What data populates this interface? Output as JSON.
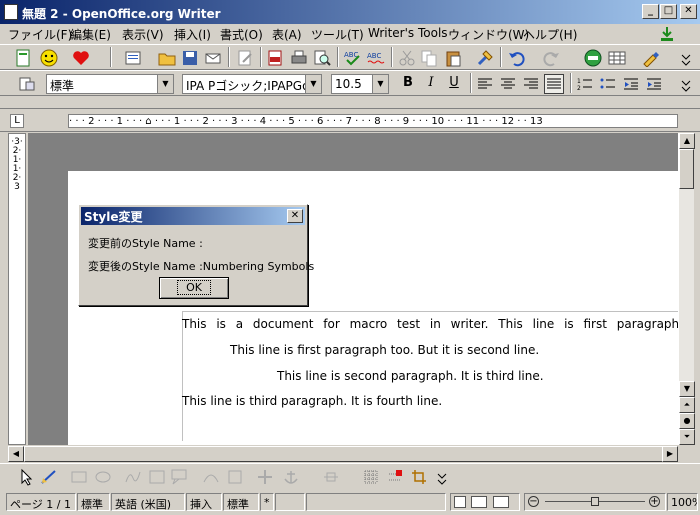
{
  "window": {
    "title": "無題 2 - OpenOffice.org Writer",
    "minimize": "_",
    "maximize": "□",
    "close": "✕"
  },
  "menu": [
    "ファイル(F)",
    "編集(E)",
    "表示(V)",
    "挿入(I)",
    "書式(O)",
    "表(A)",
    "ツール(T)",
    "Writer's Tools",
    "ウィンドウ(W)",
    "ヘルプ(H)"
  ],
  "format_bar": {
    "style": "標準",
    "font": "IPA Pゴシック;IPAPGothic",
    "size": "10.5",
    "bold": "B",
    "italic": "I",
    "underline": "U"
  },
  "ruler": {
    "marks": "· · · 2 · · · 1 · · · ⌂ · · · 1 · · · 2 · · · 3 · · · 4 · · · 5 · · · 6 · · · 7 · · · 8 · · · 9 · · · 10 · · · 11 · · · 12 · · 13"
  },
  "vruler": {
    "marks": "·3·2·1·1·2·3"
  },
  "document": {
    "paragraphs": [
      "This is a document for macro test in writer. This line is first paragraph and",
      "This line is first paragraph too. But it is second line.",
      "This line is second paragraph. It is third line.",
      "This line is third  paragraph. It is fourth line."
    ]
  },
  "dialog": {
    "title": "Style変更",
    "line1": "変更前のStyle Name :",
    "line2": "変更後のStyle Name :Numbering Symbols",
    "ok": "OK"
  },
  "status": {
    "page": "ページ 1 / 1",
    "style": "標準",
    "language": "英語 (米国)",
    "insert": "挿入",
    "selection": "標準",
    "modified": "*",
    "zoom": "100%"
  }
}
